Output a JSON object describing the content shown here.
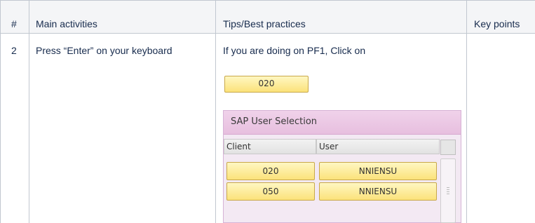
{
  "table": {
    "headers": [
      "#",
      "Main activities",
      "Tips/Best practices",
      "Key points"
    ],
    "row": {
      "number": "2",
      "activity": "Press “Enter” on your keyboard",
      "tip": "If you are doing on PF1, Click on"
    }
  },
  "sap_button": {
    "label": "020"
  },
  "sap_dialog": {
    "title": "SAP User Selection",
    "columns": [
      "Client",
      "User"
    ],
    "rows": [
      {
        "client": "020",
        "user": "NNIENSU"
      },
      {
        "client": "050",
        "user": "NNIENSU"
      }
    ]
  },
  "colors": {
    "header_bg": "#f4f5f7",
    "grid_line": "#c1c7d0",
    "sap_button_yellow": "#fbe27a",
    "sap_dialog_pink": "#e7bfdf"
  }
}
